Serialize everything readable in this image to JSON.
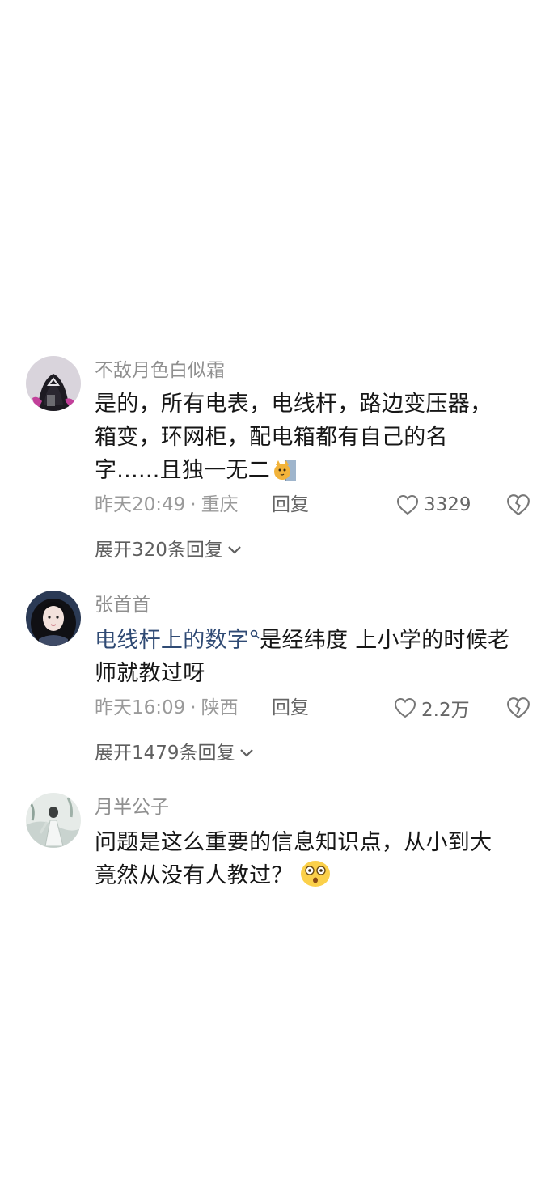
{
  "comments": [
    {
      "username": "不敌月色白似霜",
      "lines": [
        "是的，所有电表，电线杆，路边变压器，",
        "箱变，环网柜，配电箱都有自己的名",
        "字......且独一无二"
      ],
      "emoji": "cat-peek-emoji",
      "time": "昨天20:49",
      "location": "重庆",
      "reply_label": "回复",
      "likes": "3329",
      "expand_label": "展开320条回复"
    },
    {
      "username": "张首首",
      "link_text": "电线杆上的数字",
      "line1_rest": "是经纬度 上小学的时候老",
      "line2": "师就教过呀",
      "time": "昨天16:09",
      "location": "陕西",
      "reply_label": "回复",
      "likes": "2.2万",
      "expand_label": "展开1479条回复"
    },
    {
      "username": "月半公子",
      "lines": [
        "问题是这么重要的信息知识点，从小到大",
        "竟然从没有人教过？"
      ],
      "emoji": "shocked-face-emoji"
    }
  ],
  "separator": "·",
  "colors": {
    "username": "#8f8f8f",
    "body_text": "#161616",
    "meta": "#9a9a9a",
    "hashtag_link": "#2f4a74"
  }
}
